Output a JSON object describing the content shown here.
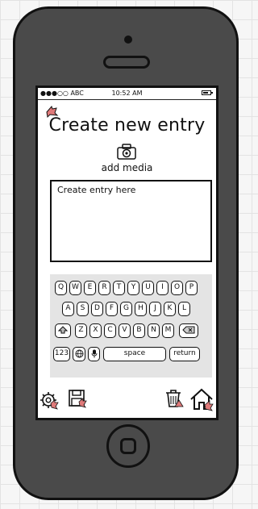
{
  "statusbar": {
    "carrier": "●●●○○ ABC",
    "time": "10:52 AM"
  },
  "screen": {
    "title": "Create new entry",
    "add_media": "add media",
    "entry_placeholder": "Create entry here"
  },
  "keyboard": {
    "row1": [
      "Q",
      "W",
      "E",
      "R",
      "T",
      "Y",
      "U",
      "I",
      "O",
      "P"
    ],
    "row2": [
      "A",
      "S",
      "D",
      "F",
      "G",
      "H",
      "J",
      "K",
      "L"
    ],
    "row3": [
      "Z",
      "X",
      "C",
      "V",
      "B",
      "N",
      "M"
    ],
    "numbers_label": "123",
    "space_label": "space",
    "return_label": "return"
  },
  "toolbar_icons": [
    "settings-icon",
    "save-icon",
    "trash-icon",
    "home-icon"
  ],
  "colors": {
    "phone_body": "#4a4a4a",
    "link_accent": "#e07a7a",
    "keyboard_bg": "#e4e4e4"
  }
}
